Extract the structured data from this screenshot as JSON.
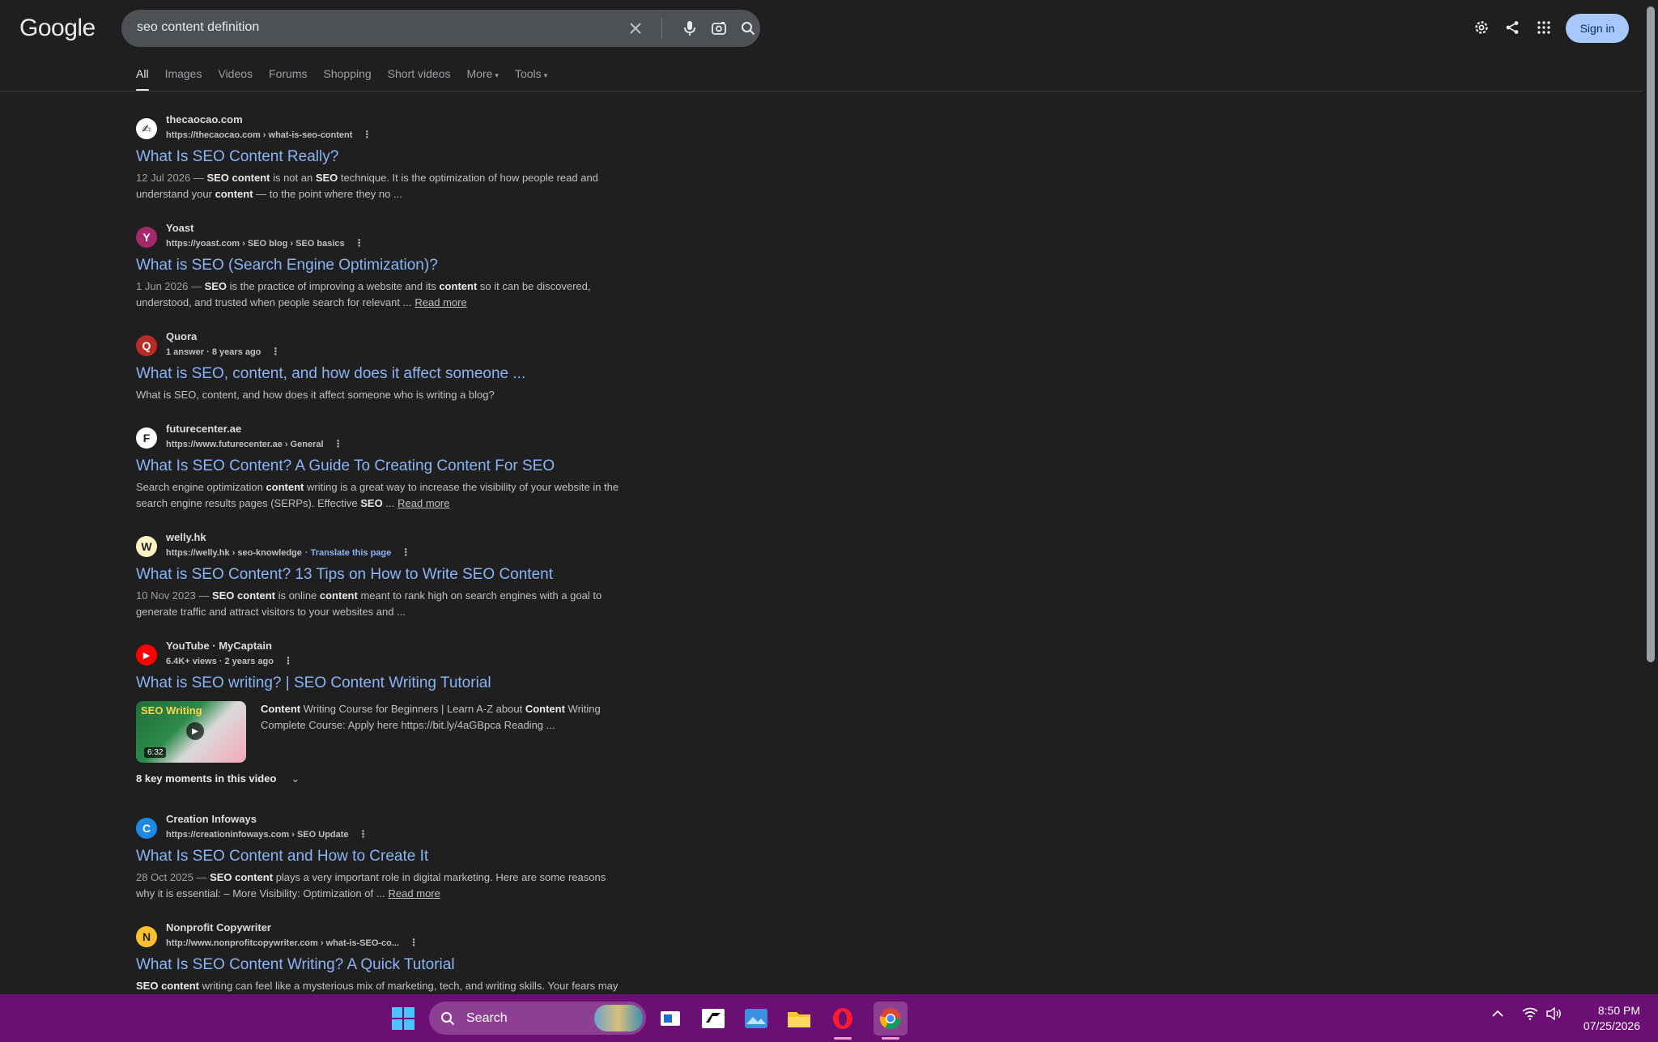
{
  "header": {
    "logo": "Google",
    "query": "seo content definition",
    "sign_in": "Sign in"
  },
  "tabs": [
    {
      "label": "All",
      "active": true
    },
    {
      "label": "Images"
    },
    {
      "label": "Videos"
    },
    {
      "label": "Forums"
    },
    {
      "label": "Shopping"
    },
    {
      "label": "Short videos"
    },
    {
      "label": "More",
      "caret": "▾"
    },
    {
      "label": "Tools",
      "caret": "▾"
    }
  ],
  "results": [
    {
      "site": "thecaocao.com",
      "url": "https://thecaocao.com › what-is-seo-content",
      "favicon": "✍",
      "title": "What Is SEO Content Really?",
      "date": "12 Jul 2026 — ",
      "snippet_html": "<b>SEO content</b> is not an <b>SEO</b> technique. It is the optimization of how people read and understand your <b>content</b> — to the point where they no ..."
    },
    {
      "site": "Yoast",
      "url": "https://yoast.com › SEO blog › SEO basics",
      "favicon": "Y",
      "title": "What is SEO (Search Engine Optimization)?",
      "date": "1 Jun 2026 — ",
      "snippet_html": "<b>SEO</b> is the practice of improving a website and its <b>content</b> so it can be discovered, understood, and trusted when people search for relevant ...",
      "read_more": "Read more"
    },
    {
      "site": "Quora",
      "url": "1 answer · 8 years ago",
      "favicon": "Q",
      "title": "What is SEO, content, and how does it affect someone ...",
      "snippet_html": "What is SEO, content, and how does it affect someone who is writing a blog?"
    },
    {
      "site": "futurecenter.ae",
      "url": "https://www.futurecenter.ae › General",
      "favicon": "F",
      "title": "What Is SEO Content? A Guide To Creating Content For SEO",
      "snippet_html": "Search engine optimization <b>content</b> writing is a great way to increase the visibility of your website in the search engine results pages (SERPs). Effective <b>SEO</b> ...",
      "read_more": "Read more"
    },
    {
      "site": "welly.hk",
      "url": "https://welly.hk › seo-knowledge",
      "translate": "· Translate this page",
      "favicon": "W",
      "title": "What is SEO Content? 13 Tips on How to Write SEO Content",
      "date": "10 Nov 2023 — ",
      "snippet_html": "<b>SEO content</b> is online <b>content</b> meant to rank high on search engines with a goal to generate traffic and attract visitors to your websites and ..."
    },
    {
      "site": "YouTube · MyCaptain",
      "url": "6.4K+ views · 2 years ago",
      "favicon": "▶",
      "title": "What is SEO writing? | SEO Content Writing Tutorial",
      "video": {
        "thumb_title": "SEO Writing",
        "duration": "6:32",
        "snippet_html": "<b>Content</b> Writing Course for Beginners | Learn A-Z about <b>Content</b> Writing Complete Course: Apply here https://bit.ly/4aGBpca Reading ...",
        "moments": "8 key moments in this video"
      }
    },
    {
      "site": "Creation Infoways",
      "url": "https://creationinfoways.com › SEO Update",
      "favicon": "C",
      "title": "What Is SEO Content and How to Create It",
      "date": "28 Oct 2025 — ",
      "snippet_html": "<b>SEO content</b> plays a very important role in digital marketing. Here are some reasons why it is essential: – More Visibility: Optimization of ...",
      "read_more": "Read more"
    },
    {
      "site": "Nonprofit Copywriter",
      "url": "http://www.nonprofitcopywriter.com › what-is-SEO-co...",
      "favicon": "N",
      "title": "What Is SEO Content Writing? A Quick Tutorial",
      "snippet_html": "<b>SEO content</b> writing can feel like a mysterious mix of marketing, tech, and writing skills. Your fears may"
    }
  ],
  "taskbar": {
    "search_label": "Search",
    "time": "8:50 PM",
    "date": "07/25/2026"
  },
  "colors": {
    "background": "#1f1f1f",
    "link": "#8ab4f8",
    "taskbar": "#6b0f74",
    "sign_in_bg": "#a8c7fa"
  }
}
